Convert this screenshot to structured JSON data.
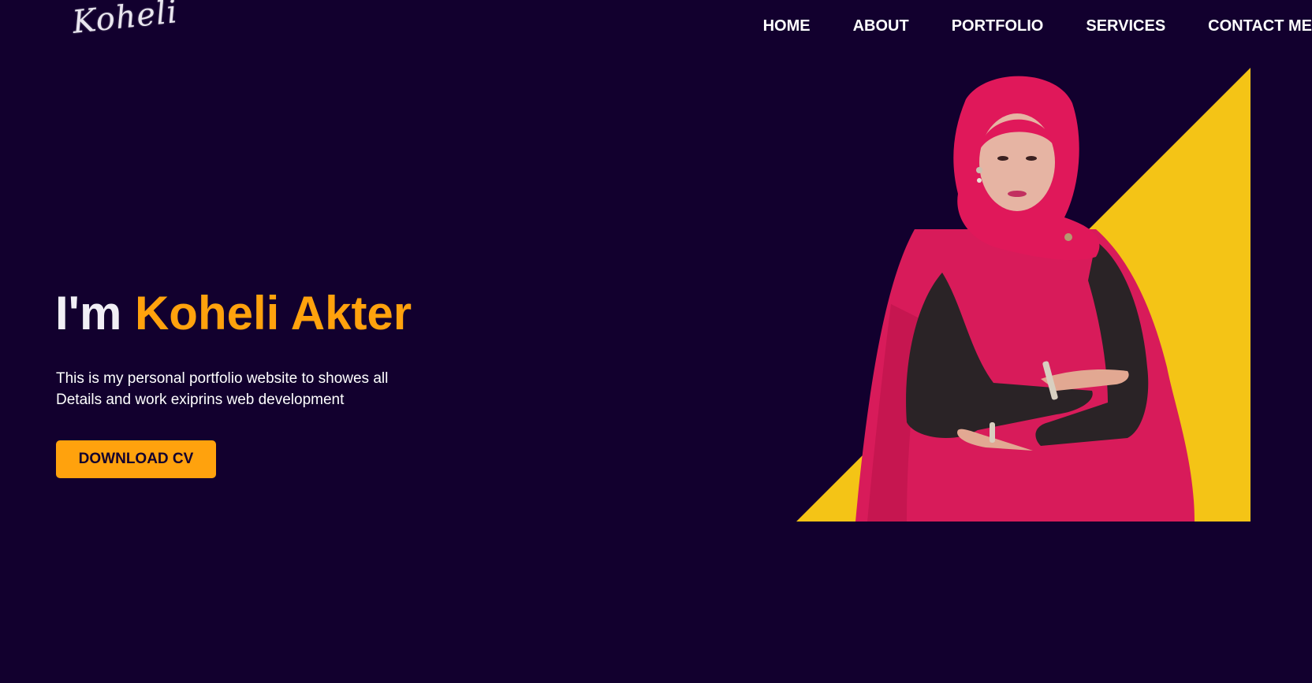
{
  "logo": {
    "text": "Koheli"
  },
  "nav": {
    "items": [
      {
        "label": "HOME"
      },
      {
        "label": "ABOUT"
      },
      {
        "label": "PORTFOLIO"
      },
      {
        "label": "SERVICES"
      },
      {
        "label": "CONTACT ME"
      }
    ]
  },
  "hero": {
    "greeting": "I'm ",
    "name": "Koheli Akter",
    "description_line1": "This is my personal portfolio website to showes all",
    "description_line2": "Details and work exiprins web development",
    "button_label": "DOWNLOAD CV"
  },
  "colors": {
    "background": "#12002e",
    "accent": "#ffa20d",
    "triangle": "#f4c416",
    "scarf": "#d81b5a",
    "sleeve": "#2a2326"
  },
  "icons": {
    "portrait": "portrait-photo"
  }
}
